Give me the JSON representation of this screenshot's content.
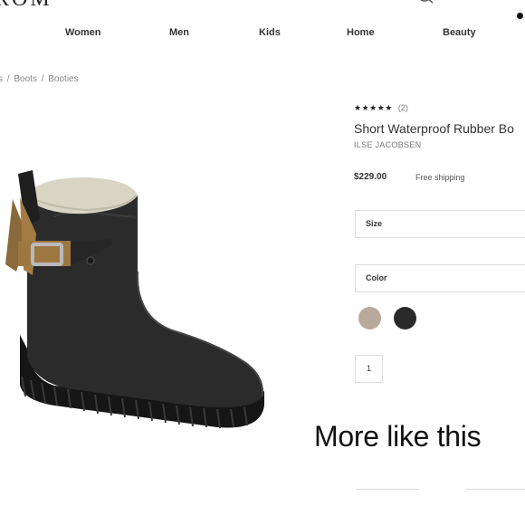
{
  "header": {
    "logo_text": "ROM"
  },
  "nav": {
    "items": [
      "Women",
      "Men",
      "Kids",
      "Home",
      "Beauty"
    ]
  },
  "breadcrumb": [
    "s",
    "/",
    "Boots",
    "/",
    "Booties"
  ],
  "product": {
    "rating_stars": "★★★★★",
    "rating_count": "(2)",
    "title": "Short Waterproof Rubber Bo",
    "brand": "ILSE JACOBSEN",
    "price": "$229.00",
    "shipping": "Free shipping",
    "size_label": "Size",
    "color_label": "Color",
    "colors": [
      "#b8a99a",
      "#2a2a2a"
    ],
    "quantity": "1"
  },
  "overlay_text": "More like this"
}
